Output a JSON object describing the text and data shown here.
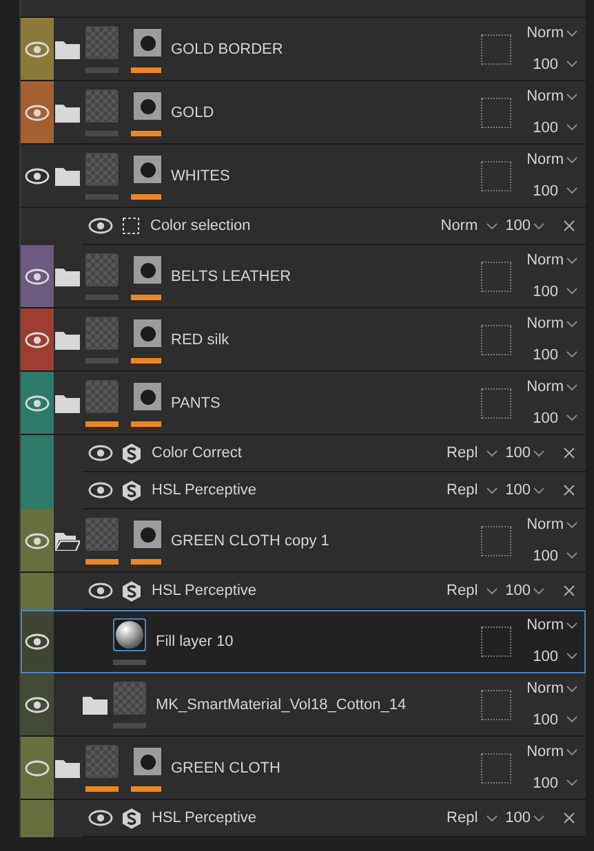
{
  "layers": [
    {
      "kind": "folder",
      "name": "GOLD BORDER",
      "color": "#8b7a37",
      "visible": true,
      "open": false,
      "selected": false,
      "blend": "Norm",
      "opacity": "100",
      "content_active": false,
      "mask_active": true
    },
    {
      "kind": "folder",
      "name": "GOLD",
      "color": "#a4602f",
      "visible": true,
      "open": false,
      "selected": false,
      "blend": "Norm",
      "opacity": "100",
      "content_active": false,
      "mask_active": true
    },
    {
      "kind": "folder",
      "name": "WHITES",
      "visible": true,
      "open": false,
      "selected": false,
      "blend": "Norm",
      "opacity": "100",
      "content_active": false,
      "mask_active": true,
      "effects": [
        {
          "kind": "selection",
          "name": "Color selection",
          "visible": true,
          "blend": "Norm",
          "opacity": "100"
        }
      ]
    },
    {
      "kind": "folder",
      "name": "BELTS LEATHER",
      "color": "#6d5a80",
      "visible": true,
      "open": false,
      "selected": false,
      "blend": "Norm",
      "opacity": "100",
      "content_active": false,
      "mask_active": true
    },
    {
      "kind": "folder",
      "name": "RED silk",
      "color": "#9f3d33",
      "visible": true,
      "open": false,
      "selected": false,
      "blend": "Norm",
      "opacity": "100",
      "content_active": false,
      "mask_active": true
    },
    {
      "kind": "folder",
      "name": "PANTS",
      "color": "#2d7a68",
      "visible": true,
      "open": false,
      "selected": false,
      "blend": "Norm",
      "opacity": "100",
      "content_active": true,
      "mask_active": true,
      "effects": [
        {
          "kind": "filter",
          "name": "Color Correct",
          "visible": true,
          "blend": "Repl",
          "opacity": "100"
        },
        {
          "kind": "filter",
          "name": "HSL Perceptive",
          "visible": true,
          "blend": "Repl",
          "opacity": "100"
        }
      ]
    },
    {
      "kind": "folder",
      "name": "GREEN CLOTH copy 1",
      "color": "#66703f",
      "visible": true,
      "open": true,
      "selected": false,
      "blend": "Norm",
      "opacity": "100",
      "content_active": true,
      "mask_active": true,
      "effects": [
        {
          "kind": "filter",
          "name": "HSL Perceptive",
          "visible": true,
          "blend": "Repl",
          "opacity": "100"
        }
      ],
      "children": [
        {
          "kind": "fill",
          "name": "Fill layer 10",
          "color": "#3f4532",
          "visible": true,
          "selected": true,
          "blend": "Norm",
          "opacity": "100",
          "content_active": false
        },
        {
          "kind": "folder",
          "name": "MK_SmartMaterial_Vol18_Cotton_14",
          "color": "#434a37",
          "visible": true,
          "open": false,
          "selected": false,
          "blend": "Norm",
          "opacity": "100",
          "content_active": false
        }
      ]
    },
    {
      "kind": "folder",
      "name": "GREEN CLOTH",
      "color": "#66703f",
      "visible": false,
      "open": false,
      "selected": false,
      "blend": "Norm",
      "opacity": "100",
      "content_active": true,
      "mask_active": true,
      "effects": [
        {
          "kind": "filter",
          "name": "HSL Perceptive",
          "visible": true,
          "blend": "Repl",
          "opacity": "100"
        }
      ]
    }
  ]
}
